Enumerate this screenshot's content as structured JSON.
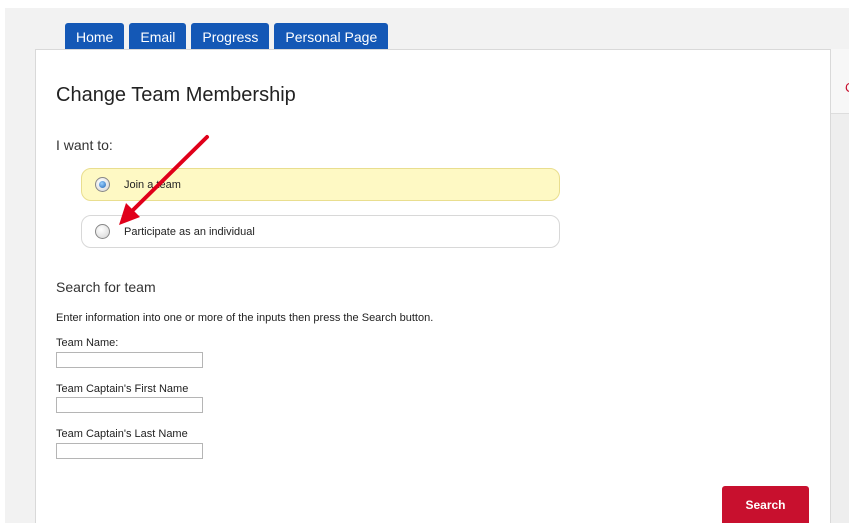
{
  "tabs": [
    {
      "label": "Home"
    },
    {
      "label": "Email"
    },
    {
      "label": "Progress"
    },
    {
      "label": "Personal Page"
    }
  ],
  "right_fragment": "C",
  "page_title": "Change Team Membership",
  "prompt": "I want to:",
  "options": [
    {
      "label": "Join a team",
      "selected": true
    },
    {
      "label": "Participate as an individual",
      "selected": false
    }
  ],
  "search": {
    "heading": "Search for team",
    "instructions": "Enter information into one or more of the inputs then press the Search button.",
    "fields": [
      {
        "label": "Team Name:",
        "value": ""
      },
      {
        "label": "Team Captain's First Name",
        "value": ""
      },
      {
        "label": "Team Captain's Last Name",
        "value": ""
      }
    ],
    "button_label": "Search"
  },
  "colors": {
    "tab_blue": "#1458b6",
    "selected_option_bg": "#fef9c4",
    "search_button_red": "#c8102e",
    "annotation_arrow": "#e0001a"
  }
}
